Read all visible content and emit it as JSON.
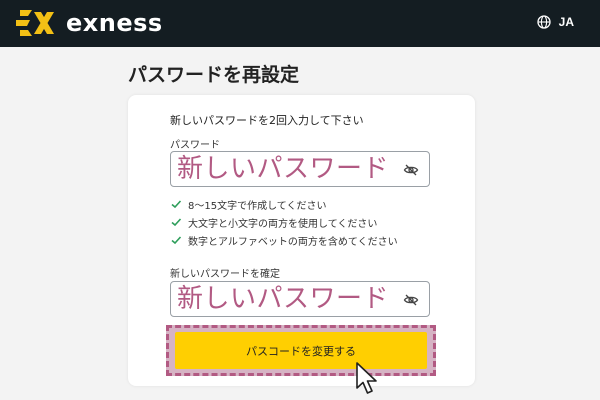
{
  "header": {
    "brand": "exness",
    "language": "JA",
    "icons": {
      "logo": "exness-logo-icon",
      "language": "globe-icon"
    }
  },
  "page": {
    "title": "パスワードを再設定"
  },
  "form": {
    "instruction": "新しいパスワードを2回入力して下さい",
    "password": {
      "label": "パスワード",
      "value": "新しいパスワード",
      "icon": "eye-off-icon"
    },
    "rules": [
      "8～15文字で作成してください",
      "大文字と小文字の両方を使用してください",
      "数字とアルファベットの両方を含めてください"
    ],
    "confirm": {
      "label": "新しいパスワードを確定",
      "value": "新しいパスワード",
      "icon": "eye-off-icon"
    },
    "submit_label": "パスコードを変更する"
  },
  "colors": {
    "header_bg": "#141d22",
    "brand_yellow": "#ffcf01",
    "annotation_pink": "#b25a83",
    "check_green": "#2e9e5b",
    "page_bg": "#f3f3f3"
  }
}
